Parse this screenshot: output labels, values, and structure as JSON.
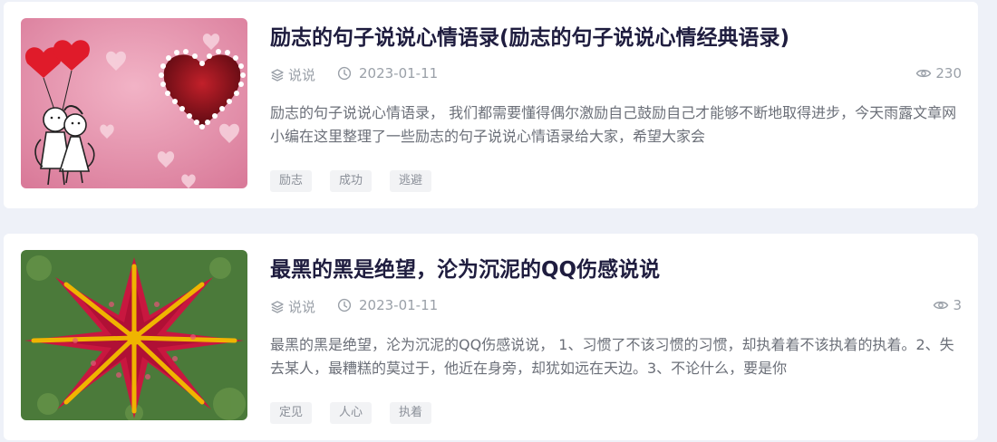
{
  "articles": [
    {
      "title": "励志的句子说说心情语录(励志的句子说说心情经典语录)",
      "category": "说说",
      "date": "2023-01-11",
      "views": "230",
      "excerpt": "励志的句子说说心情语录， 我们都需要懂得偶尔激励自己鼓励自己才能够不断地取得进步，今天雨露文章网小编在这里整理了一些励志的句子说说心情语录给大家，希望大家会",
      "tags": [
        "励志",
        "成功",
        "逃避"
      ]
    },
    {
      "title": "最黑的黑是绝望，沦为沉泥的QQ伤感说说",
      "category": "说说",
      "date": "2023-01-11",
      "views": "3",
      "excerpt": "最黑的黑是绝望，沦为沉泥的QQ伤感说说， 1、习惯了不该习惯的习惯，却执着着不该执着的执着。2、失去某人，最糟糕的莫过于，他近在身旁，却犹如远在天边。3、不论什么，要是你",
      "tags": [
        "定见",
        "人心",
        "执着"
      ]
    }
  ],
  "icons": {
    "category": "tag-stack-icon",
    "date": "clock-icon",
    "views": "eye-icon"
  },
  "colors": {
    "page_bg": "#eef1f8",
    "title": "#1f1d3f",
    "meta": "#9aa0a8",
    "tag_bg": "#f2f3f5"
  }
}
